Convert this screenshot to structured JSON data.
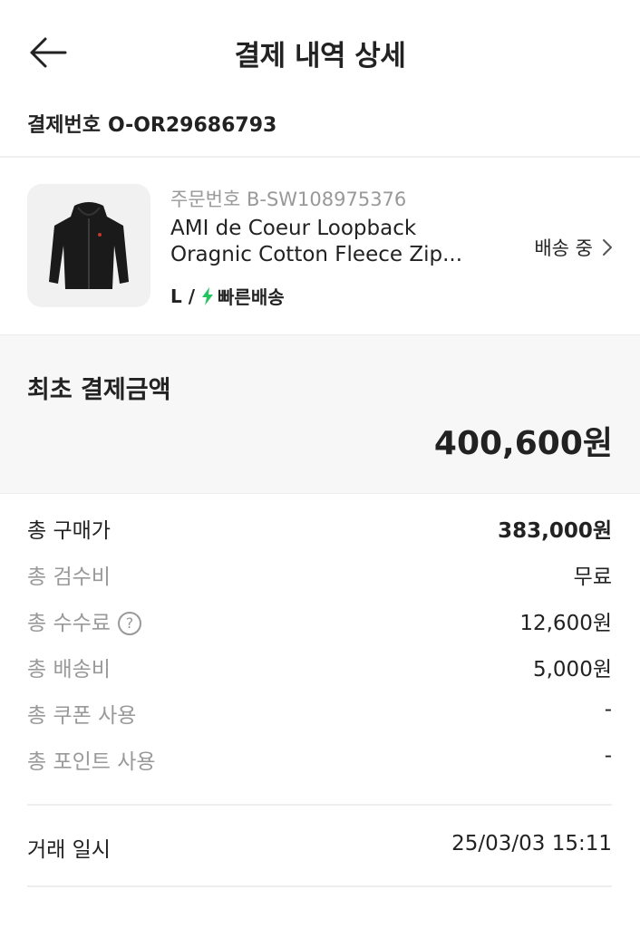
{
  "header": {
    "title": "결제 내역 상세"
  },
  "payment": {
    "label": "결제번호",
    "number": "O-OR29686793"
  },
  "product": {
    "order_label": "주문번호 B-SW108975376",
    "name_line1": "AMI de Coeur Loopback",
    "name_line2": "Oragnic Cotton Fleece Zip...",
    "size": "L /",
    "delivery_type": "빠른배송",
    "status": "배송 중"
  },
  "initial_payment": {
    "label": "최초 결제금액",
    "amount": "400,600원"
  },
  "breakdown": [
    {
      "label": "총 구매가",
      "value": "383,000원"
    },
    {
      "label": "총 검수비",
      "value": "무료"
    },
    {
      "label": "총 수수료",
      "value": "12,600원",
      "help": "?"
    },
    {
      "label": "총 배송비",
      "value": "5,000원"
    },
    {
      "label": "총 쿠폰 사용",
      "value": "-"
    },
    {
      "label": "총 포인트 사용",
      "value": "-"
    }
  ],
  "transaction": {
    "label": "거래 일시",
    "value": "25/03/03 15:11"
  },
  "colors": {
    "accent_green": "#22c55e",
    "muted_text": "#999999",
    "band_bg": "#f7f7f7"
  }
}
